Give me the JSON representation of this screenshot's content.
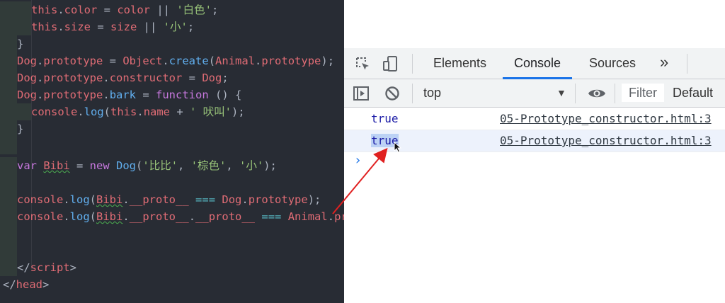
{
  "editor": {
    "lines": [
      {
        "indent": 2,
        "tokens": [
          [
            "th",
            "this"
          ],
          [
            "pl",
            "."
          ],
          [
            "pr",
            "color"
          ],
          [
            "pl",
            " = "
          ],
          [
            "pr",
            "color"
          ],
          [
            "pl",
            " || "
          ],
          [
            "st",
            "'白色'"
          ],
          [
            "pl",
            ";"
          ]
        ]
      },
      {
        "indent": 2,
        "tokens": [
          [
            "th",
            "this"
          ],
          [
            "pl",
            "."
          ],
          [
            "pr",
            "size"
          ],
          [
            "pl",
            " = "
          ],
          [
            "pr",
            "size"
          ],
          [
            "pl",
            " || "
          ],
          [
            "st",
            "'小'"
          ],
          [
            "pl",
            ";"
          ]
        ]
      },
      {
        "indent": 1,
        "tokens": [
          [
            "pl",
            "}"
          ]
        ]
      },
      {
        "indent": 1,
        "tokens": [
          [
            "th",
            "Dog"
          ],
          [
            "pl",
            "."
          ],
          [
            "pr",
            "prototype"
          ],
          [
            "pl",
            " = "
          ],
          [
            "th",
            "Object"
          ],
          [
            "pl",
            "."
          ],
          [
            "fn",
            "create"
          ],
          [
            "pl",
            "("
          ],
          [
            "th",
            "Animal"
          ],
          [
            "pl",
            "."
          ],
          [
            "pr",
            "prototype"
          ],
          [
            "pl",
            ");"
          ]
        ]
      },
      {
        "indent": 1,
        "tokens": [
          [
            "th",
            "Dog"
          ],
          [
            "pl",
            "."
          ],
          [
            "pr",
            "prototype"
          ],
          [
            "pl",
            "."
          ],
          [
            "pr",
            "constructor"
          ],
          [
            "pl",
            " = "
          ],
          [
            "th",
            "Dog"
          ],
          [
            "pl",
            ";"
          ]
        ]
      },
      {
        "indent": 1,
        "tokens": [
          [
            "th",
            "Dog"
          ],
          [
            "pl",
            "."
          ],
          [
            "pr",
            "prototype"
          ],
          [
            "pl",
            "."
          ],
          [
            "fn",
            "bark"
          ],
          [
            "pl",
            " = "
          ],
          [
            "kw",
            "function"
          ],
          [
            "pl",
            " () {"
          ]
        ]
      },
      {
        "indent": 2,
        "tokens": [
          [
            "th",
            "console"
          ],
          [
            "pl",
            "."
          ],
          [
            "fn",
            "log"
          ],
          [
            "pl",
            "("
          ],
          [
            "th",
            "this"
          ],
          [
            "pl",
            "."
          ],
          [
            "pr",
            "name"
          ],
          [
            "pl",
            " + "
          ],
          [
            "st",
            "' 吠叫'"
          ],
          [
            "pl",
            ");"
          ]
        ]
      },
      {
        "indent": 1,
        "tokens": [
          [
            "pl",
            "}"
          ]
        ]
      },
      {
        "indent": 1,
        "tokens": []
      },
      {
        "indent": 1,
        "tokens": [
          [
            "kw",
            "var"
          ],
          [
            "pl",
            " "
          ],
          [
            "th sq",
            "Bibi"
          ],
          [
            "pl",
            " = "
          ],
          [
            "kw",
            "new"
          ],
          [
            "pl",
            " "
          ],
          [
            "fn",
            "Dog"
          ],
          [
            "pl",
            "("
          ],
          [
            "st",
            "'比比'"
          ],
          [
            "pl",
            ", "
          ],
          [
            "st",
            "'棕色'"
          ],
          [
            "pl",
            ", "
          ],
          [
            "st",
            "'小'"
          ],
          [
            "pl",
            ");"
          ]
        ]
      },
      {
        "indent": 1,
        "tokens": []
      },
      {
        "indent": 1,
        "tokens": [
          [
            "th",
            "console"
          ],
          [
            "pl",
            "."
          ],
          [
            "fn",
            "log"
          ],
          [
            "pl",
            "("
          ],
          [
            "th sq",
            "Bibi"
          ],
          [
            "pl",
            "."
          ],
          [
            "pr",
            "__proto__"
          ],
          [
            "pl",
            " "
          ],
          [
            "op",
            "==="
          ],
          [
            "pl",
            " "
          ],
          [
            "th",
            "Dog"
          ],
          [
            "pl",
            "."
          ],
          [
            "pr",
            "prototype"
          ],
          [
            "pl",
            ");"
          ]
        ]
      },
      {
        "indent": 1,
        "tokens": [
          [
            "th",
            "console"
          ],
          [
            "pl",
            "."
          ],
          [
            "fn",
            "log"
          ],
          [
            "pl",
            "("
          ],
          [
            "th sq",
            "Bibi"
          ],
          [
            "pl",
            "."
          ],
          [
            "pr",
            "__proto__"
          ],
          [
            "pl",
            "."
          ],
          [
            "pr",
            "__proto__"
          ],
          [
            "pl",
            " "
          ],
          [
            "op",
            "==="
          ],
          [
            "pl",
            " "
          ],
          [
            "th",
            "Animal"
          ],
          [
            "pl",
            "."
          ],
          [
            "pr",
            "prototype"
          ],
          [
            "pl",
            ");"
          ]
        ]
      },
      {
        "indent": 1,
        "tokens": []
      },
      {
        "indent": 1,
        "tokens": []
      },
      {
        "indent": 1,
        "tokens": [
          [
            "pl",
            "</"
          ],
          [
            "tg",
            "script"
          ],
          [
            "pl",
            ">"
          ]
        ]
      },
      {
        "indent": 0,
        "tokens": [
          [
            "pl",
            "</"
          ],
          [
            "tg",
            "head"
          ],
          [
            "pl",
            ">"
          ]
        ]
      }
    ]
  },
  "devtools": {
    "tabs": [
      "Elements",
      "Console",
      "Sources"
    ],
    "active_tab": "Console",
    "more_label": "»",
    "context": "top",
    "filter_placeholder": "Filter",
    "levels_label": "Default",
    "prompt_symbol": "›",
    "rows": [
      {
        "value": "true",
        "source": "05-Prototype_constructor.html:3",
        "highlighted": false
      },
      {
        "value": "true",
        "source": "05-Prototype_constructor.html:3",
        "highlighted": true
      }
    ]
  },
  "icons": [
    "inspect-icon",
    "device-toggle-icon",
    "sidebar-toggle-icon",
    "clear-console-icon",
    "context-caret-icon",
    "eye-icon",
    "mouse-cursor-icon"
  ],
  "colors": {
    "editor_bg": "#282c34",
    "accent": "#1a73e8",
    "console_value": "#1a1aa6",
    "arrow": "#e02020"
  }
}
